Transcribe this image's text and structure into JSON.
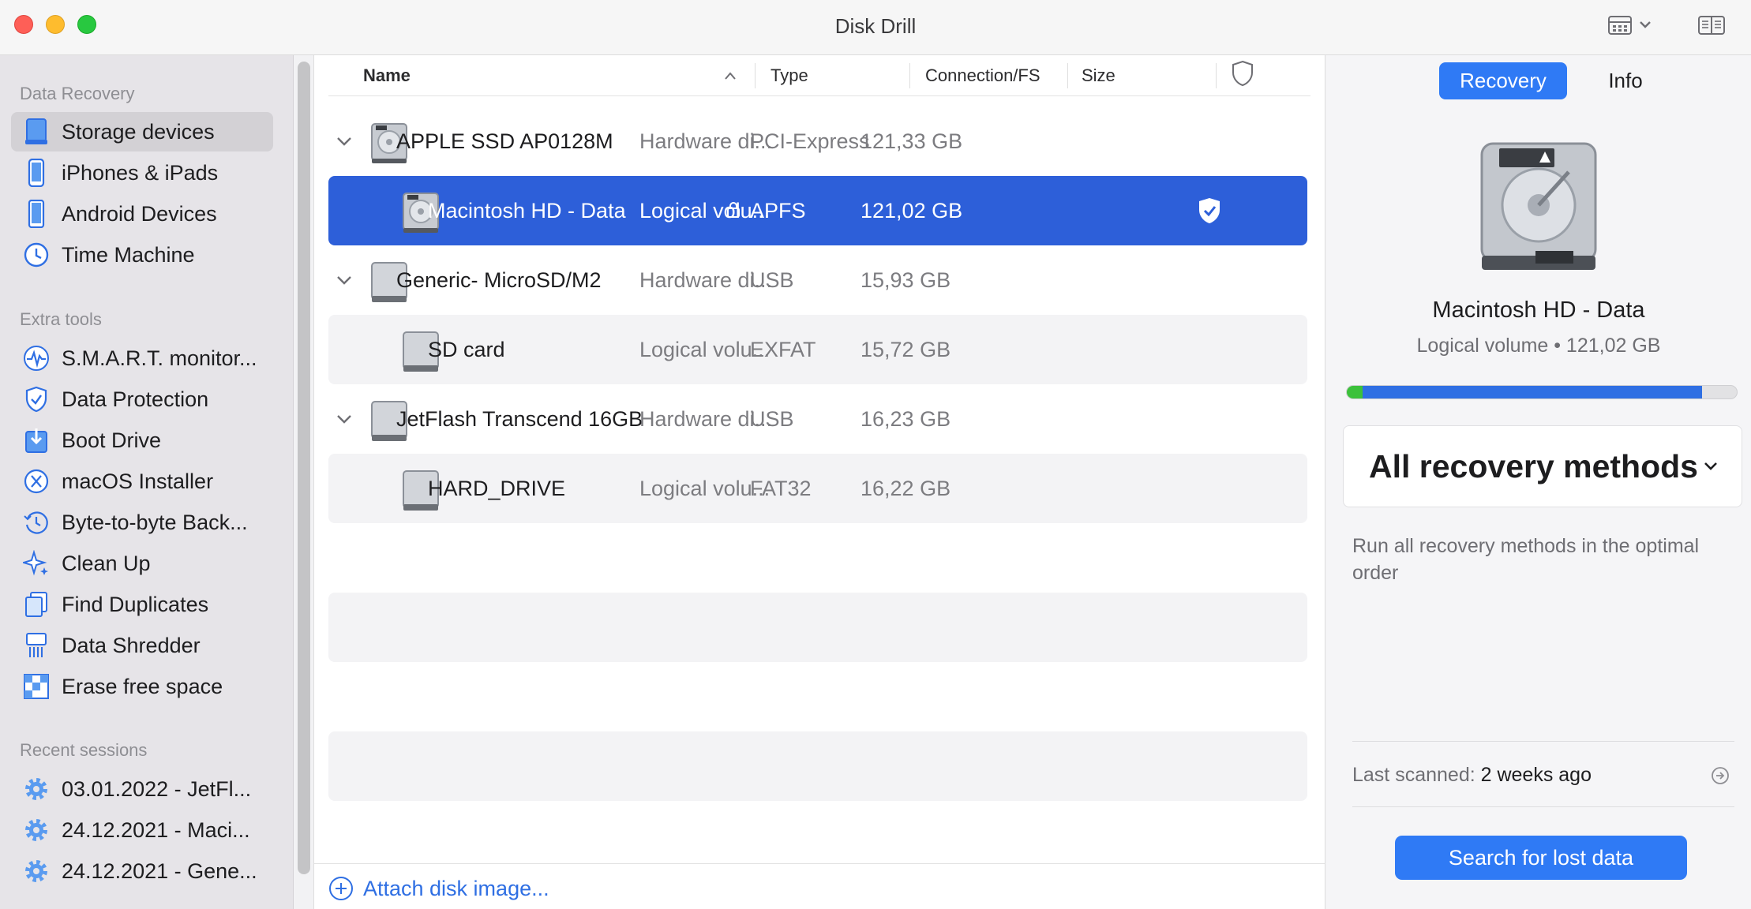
{
  "window": {
    "title": "Disk Drill"
  },
  "sidebar": {
    "sections": [
      {
        "header": "Data Recovery"
      },
      {
        "header": "Extra tools"
      },
      {
        "header": "Recent sessions"
      }
    ],
    "data_recovery": [
      {
        "label": "Storage devices",
        "icon": "hard-drive-icon",
        "active": true
      },
      {
        "label": "iPhones & iPads",
        "icon": "iphone-icon"
      },
      {
        "label": "Android Devices",
        "icon": "android-phone-icon"
      },
      {
        "label": "Time Machine",
        "icon": "time-machine-icon"
      }
    ],
    "extra_tools": [
      {
        "label": "S.M.A.R.T. monitor...",
        "icon": "smart-monitor-icon"
      },
      {
        "label": "Data Protection",
        "icon": "shield-icon"
      },
      {
        "label": "Boot Drive",
        "icon": "boot-drive-icon"
      },
      {
        "label": "macOS Installer",
        "icon": "macos-installer-icon"
      },
      {
        "label": "Byte-to-byte Back...",
        "icon": "backup-clock-icon"
      },
      {
        "label": "Clean Up",
        "icon": "sparkle-icon"
      },
      {
        "label": "Find Duplicates",
        "icon": "duplicates-icon"
      },
      {
        "label": "Data Shredder",
        "icon": "shredder-icon"
      },
      {
        "label": "Erase free space",
        "icon": "erase-icon"
      }
    ],
    "recent_sessions": [
      {
        "label": "03.01.2022 - JetFl...",
        "icon": "gear-icon"
      },
      {
        "label": "24.12.2021 - Maci...",
        "icon": "gear-icon"
      },
      {
        "label": "24.12.2021 - Gene...",
        "icon": "gear-icon"
      }
    ]
  },
  "table": {
    "columns": {
      "name": "Name",
      "type": "Type",
      "connection": "Connection/FS",
      "size": "Size"
    },
    "rows": [
      {
        "name": "APPLE SSD AP0128M",
        "type": "Hardware di...",
        "connection": "PCI-Express",
        "size": "121,33 GB",
        "level": 0,
        "expandable": true
      },
      {
        "name": "Macintosh HD - Data",
        "type": "Logical volu...",
        "connection": "APFS",
        "size": "121,02 GB",
        "level": 1,
        "selected": true,
        "locked": true,
        "protected": true
      },
      {
        "name": "Generic- MicroSD/M2",
        "type": "Hardware di...",
        "connection": "USB",
        "size": "15,93 GB",
        "level": 0,
        "expandable": true
      },
      {
        "name": "SD card",
        "type": "Logical volu...",
        "connection": "EXFAT",
        "size": "15,72 GB",
        "level": 1
      },
      {
        "name": "JetFlash Transcend 16GB",
        "type": "Hardware di...",
        "connection": "USB",
        "size": "16,23 GB",
        "level": 0,
        "expandable": true
      },
      {
        "name": "HARD_DRIVE",
        "type": "Logical volu...",
        "connection": "FAT32",
        "size": "16,22 GB",
        "level": 1
      }
    ],
    "attach_label": "Attach disk image..."
  },
  "panel": {
    "tab_recovery": "Recovery",
    "tab_info": "Info",
    "disk_name": "Macintosh HD - Data",
    "disk_sub": "Logical volume • 121,02 GB",
    "usage": {
      "green_fraction": 0.04,
      "blue_fraction": 0.87
    },
    "method_title": "All recovery methods",
    "method_desc": "Run all recovery methods in the optimal order",
    "last_scanned_label": "Last scanned:",
    "last_scanned_value": "2 weeks ago",
    "search_button": "Search for lost data"
  },
  "colors": {
    "accent": "#2f7af5",
    "selection": "#2d5fd9",
    "progress_green": "#3cc13b"
  }
}
